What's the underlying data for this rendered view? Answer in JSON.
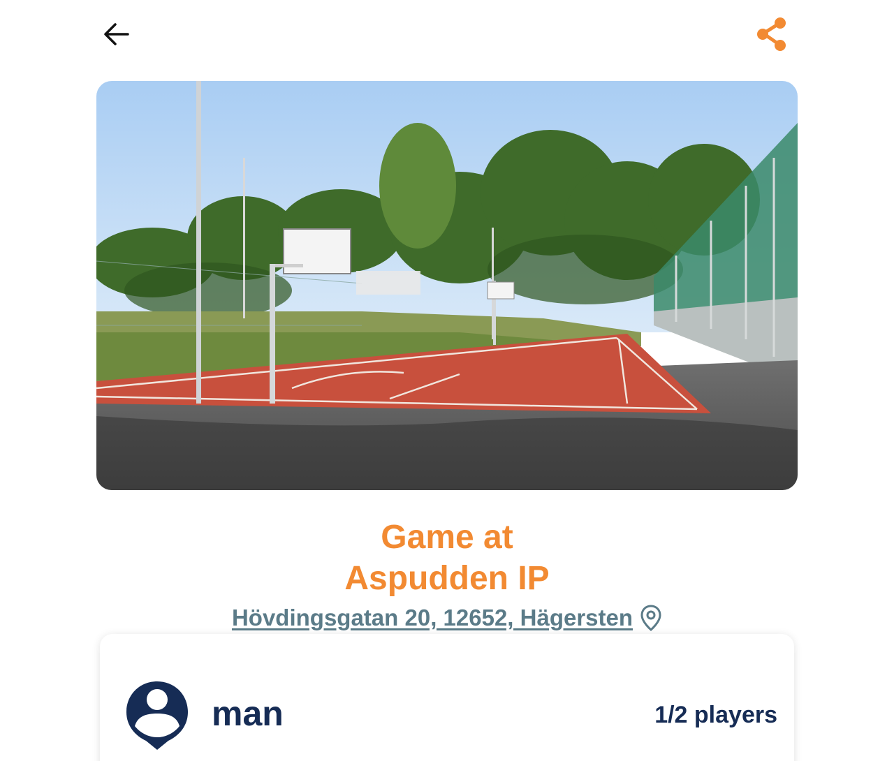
{
  "header": {
    "back_icon": "arrow-left-icon",
    "share_icon": "share-icon",
    "accent_color": "#f28a32"
  },
  "hero_image": {
    "subject": "outdoor basketball court photo"
  },
  "game": {
    "title_line1": "Game at",
    "title_line2": "Aspudden IP",
    "address": "Hövdingsgatan 20, 12652, Hägersten",
    "address_icon": "map-pin-icon",
    "title_color": "#f28a32",
    "address_color": "#5b7b88"
  },
  "host_card": {
    "avatar_icon": "user-pin-icon",
    "host_name": "man",
    "players": "1/2 players",
    "text_color": "#162c55"
  }
}
